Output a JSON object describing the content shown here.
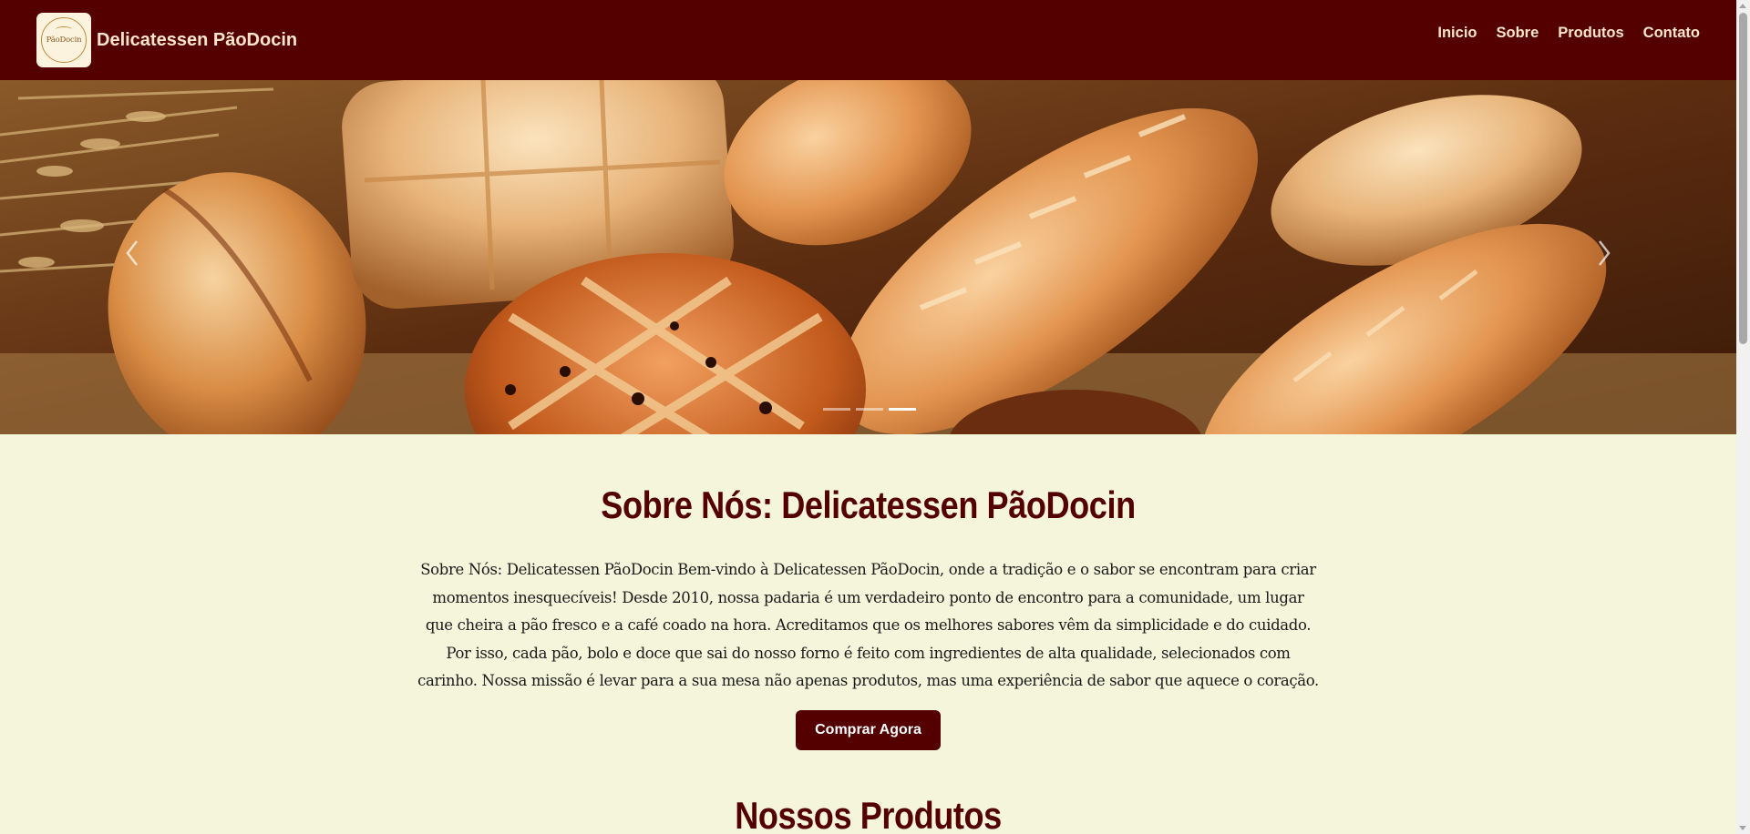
{
  "header": {
    "logo_text": "PãoDocin",
    "brand_name": "Delicatessen PãoDocin",
    "nav": [
      {
        "label": "Inicio"
      },
      {
        "label": "Sobre"
      },
      {
        "label": "Produtos"
      },
      {
        "label": "Contato"
      }
    ]
  },
  "carousel": {
    "slide_count": 3,
    "active_index": 2,
    "prev_icon": "chevron-left-icon",
    "next_icon": "chevron-right-icon"
  },
  "about": {
    "title": "Sobre Nós: Delicatessen PãoDocin",
    "text": "Sobre Nós: Delicatessen PãoDocin Bem-vindo à Delicatessen PãoDocin, onde a tradição e o sabor se encontram para criar momentos inesquecíveis! Desde 2010, nossa padaria é um verdadeiro ponto de encontro para a comunidade, um lugar que cheira a pão fresco e a café coado na hora. Acreditamos que os melhores sabores vêm da simplicidade e do cuidado. Por isso, cada pão, bolo e doce que sai do nosso forno é feito com ingredientes de alta qualidade, selecionados com carinho. Nossa missão é levar para a sua mesa não apenas produtos, mas uma experiência de sabor que aquece o coração.",
    "cta_label": "Comprar Agora"
  },
  "products": {
    "title": "Nossos Produtos"
  },
  "colors": {
    "brand": "#550000",
    "background": "#f5f5dc",
    "nav_text": "#fbe6c9"
  }
}
